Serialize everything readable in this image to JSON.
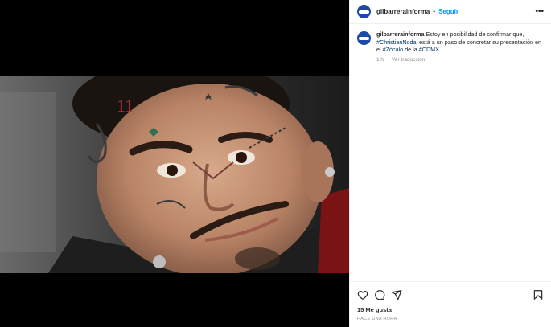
{
  "post": {
    "username": "gilbarrerainforma",
    "separator": "•",
    "follow_label": "Seguir",
    "more_label": "•••"
  },
  "media": {
    "alt": "Retrato de Christian Nodal sonriendo con tatuajes en el rostro"
  },
  "caption": {
    "username": "gilbarrerainforma",
    "text_1": "Estoy en posibilidad de confirmar que,",
    "tag_1": "#ChristianNodal",
    "text_2": "está a un paso de concretar su presentación en el",
    "tag_2": "#Zócalo",
    "text_3": "de la",
    "tag_3": "#CDMX",
    "age": "1 h",
    "translate_label": "Ver traducción"
  },
  "actions": {
    "like_icon": "heart-icon",
    "comment_icon": "comment-icon",
    "share_icon": "send-icon",
    "save_icon": "bookmark-icon"
  },
  "likes_text": "15 Me gusta",
  "timestamp": "Hace una hora",
  "colors": {
    "link_blue": "#0095f6",
    "hashtag": "#00376b",
    "avatar": "#1d4aa8",
    "muted": "#8e8e8e"
  }
}
